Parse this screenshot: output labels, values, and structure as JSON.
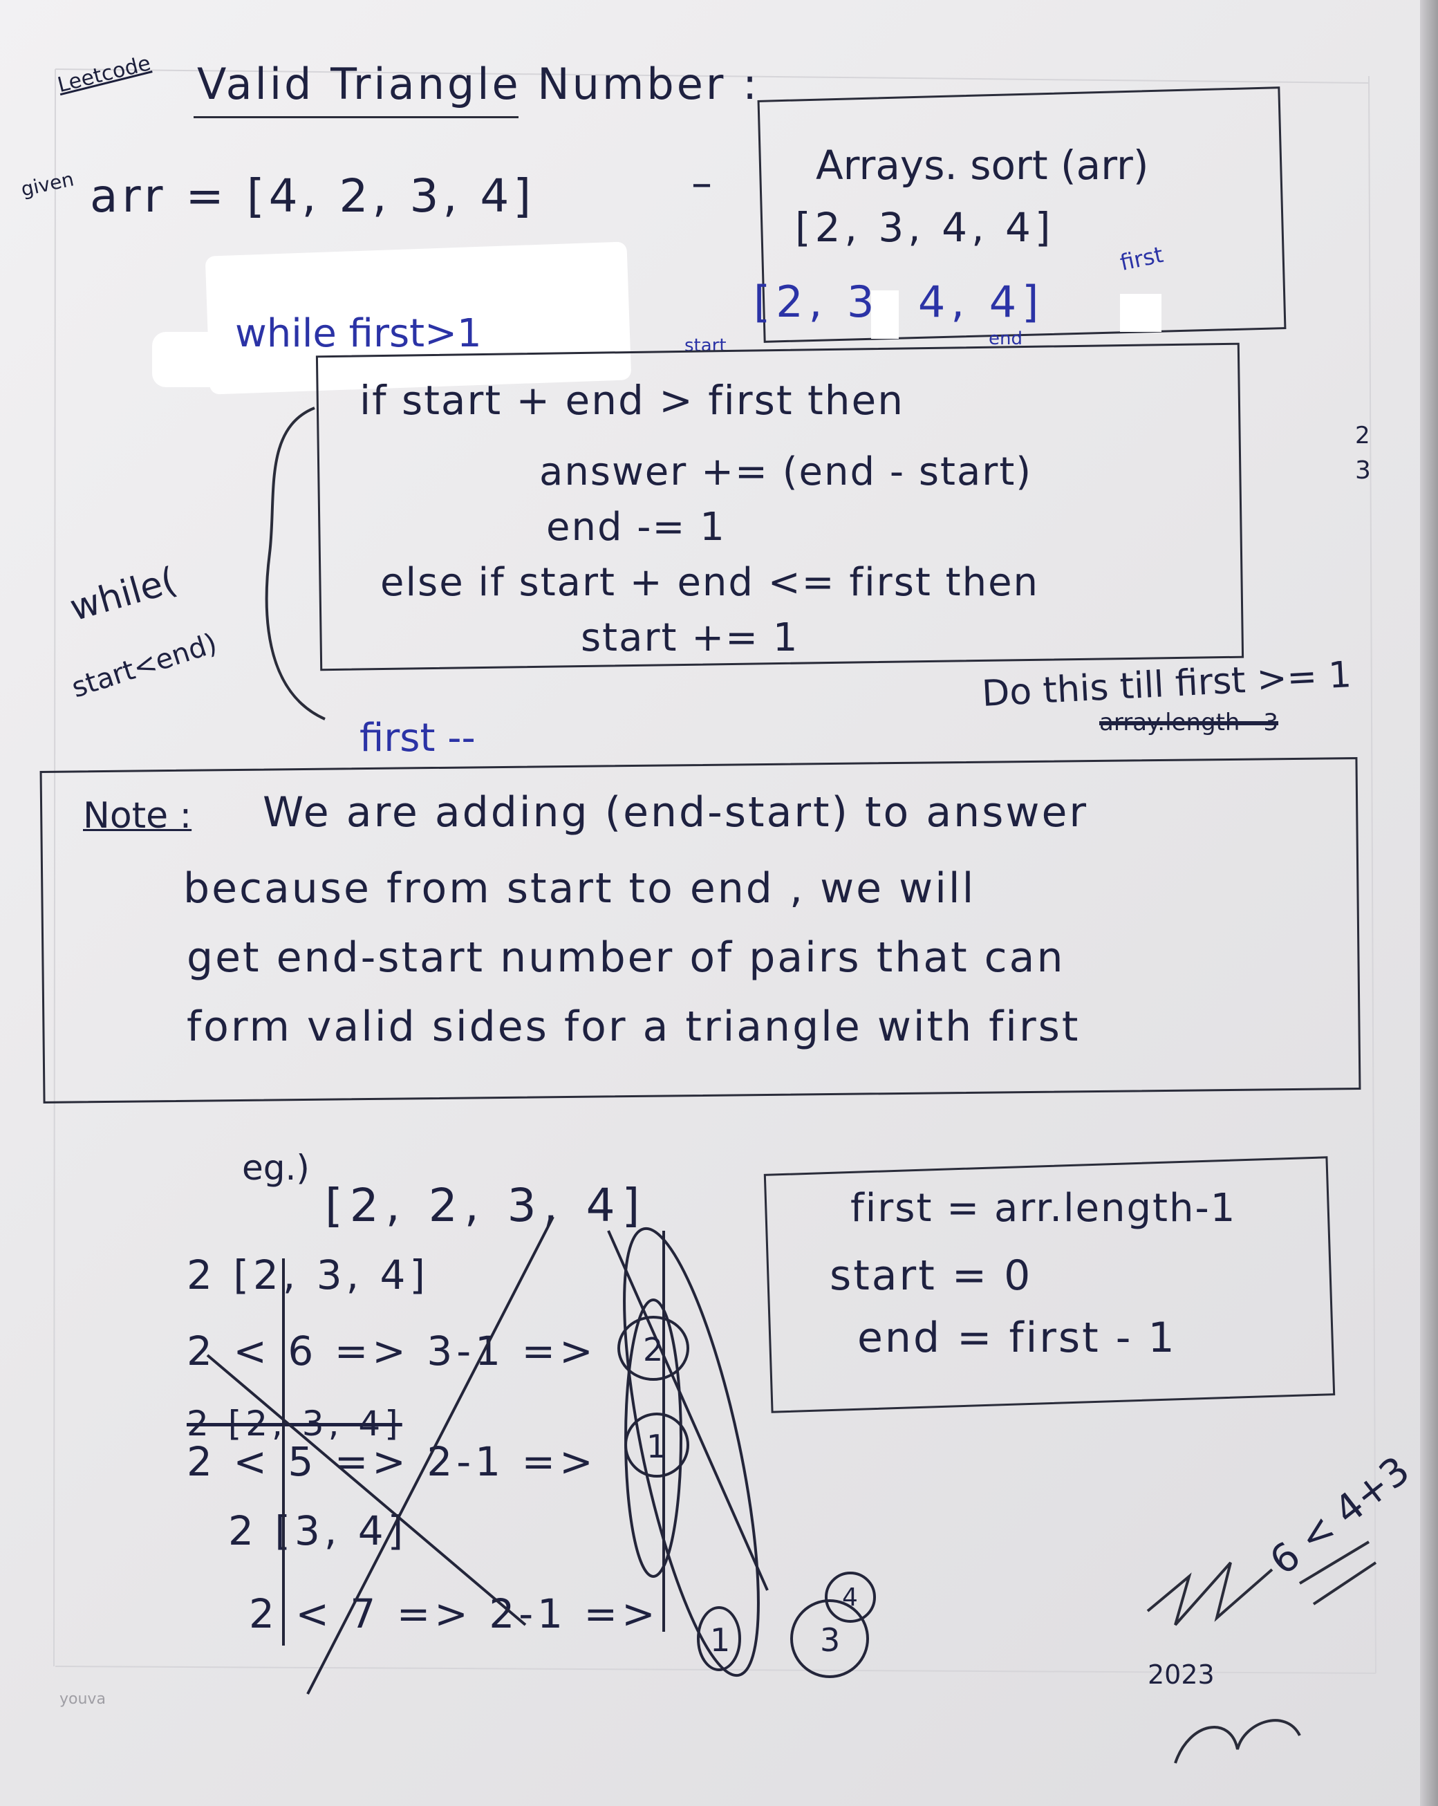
{
  "header": {
    "source": "Leetcode",
    "title": "Valid Triangle Number :"
  },
  "given": {
    "label": "given",
    "arr_line": "arr = [4, 2, 3, 4]",
    "dash": "–"
  },
  "sort_box": {
    "line1": "Arrays. sort (arr)",
    "line2": "[2, 3, 4, 4]",
    "line3": "[2, 3, 4, 4]",
    "first_label": "first",
    "start_label": "start",
    "end_label": "end"
  },
  "loop": {
    "outer": "while first>1",
    "if_line": "if start + end > first then",
    "answer_line": "answer += (end - start)",
    "dec_line": "end -= 1",
    "else_line": "else if   start + end <= first then",
    "inc_line": "start += 1",
    "while_label": "while(",
    "cond_label": "start<end)",
    "side_2": "2",
    "side_3": "3",
    "do_line": "Do this till first >= 1",
    "struck": "array.length - 3",
    "first_dec": "first --"
  },
  "note": {
    "label": "Note :",
    "line1": "We are adding (end-start) to answer",
    "line2": "because from start to end , we will",
    "line3": "get  end-start number of pairs that can",
    "line4": "form  valid sides for a triangle with first"
  },
  "example": {
    "label": "eg.)",
    "array": "[2, 2, 3, 4]",
    "rows": [
      {
        "text": "2 [2, 3, 4]"
      },
      {
        "text": "2 < 6  =>  3-1 =>"
      },
      {
        "text": "2 [2, 3, 4]"
      },
      {
        "text": "2 < 5  =>  2-1 =>"
      },
      {
        "text": "2 [3, 4]"
      },
      {
        "text": "2 < 7  =>  2-1 =>"
      }
    ],
    "circled": [
      "2",
      "1",
      "1",
      "3",
      "4"
    ]
  },
  "init_box": {
    "line1": "first = arr.length-1",
    "line2": "start = 0",
    "line3": "end = first - 1"
  },
  "scribbles": {
    "right": "6 < 4+3",
    "bottom": "2023"
  },
  "watermark": "youva",
  "colors": {
    "paper": "#ecebed",
    "ink": "#1e2140",
    "blue_ink": "#2b33a6",
    "redaction": "#ffffff"
  }
}
